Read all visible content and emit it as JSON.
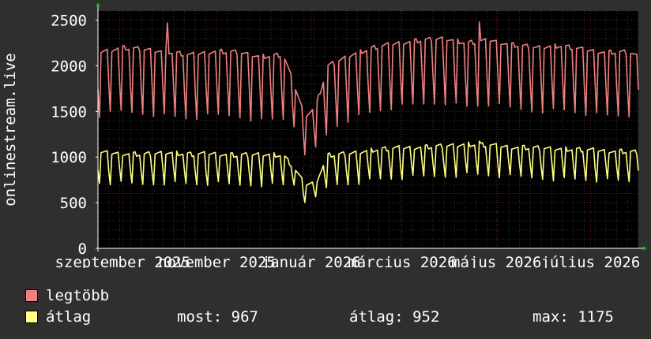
{
  "chart_data": {
    "type": "line",
    "title": "",
    "ylabel": "onlinestream.live",
    "xlabel": "",
    "ylim": [
      0,
      2600
    ],
    "yticks": [
      0,
      500,
      1000,
      1500,
      2000,
      2500
    ],
    "ytick_labels": [
      "0",
      "500",
      "1000",
      "1500",
      "2000",
      "2500"
    ],
    "xlim": [
      "2025-08-16",
      "2026-08-01"
    ],
    "xtick_labels": [
      {
        "label": "szeptember 2025",
        "date": "2025-09-01"
      },
      {
        "label": "november 2025",
        "date": "2025-11-01"
      },
      {
        "label": "január 2026",
        "date": "2026-01-01"
      },
      {
        "label": "március 2026",
        "date": "2026-03-01"
      },
      {
        "label": "május 2026",
        "date": "2026-05-01"
      },
      {
        "label": "július 2026",
        "date": "2026-07-01"
      }
    ],
    "series": [
      {
        "name": "legtöbb",
        "color": "#f08080",
        "points": [
          [
            "2025-08-16",
            2150
          ],
          [
            "2025-08-31",
            2200
          ],
          [
            "2025-09-15",
            2180
          ],
          [
            "2025-09-30",
            2150
          ],
          [
            "2025-10-15",
            2120
          ],
          [
            "2025-10-30",
            2160
          ],
          [
            "2025-11-14",
            2150
          ],
          [
            "2025-11-29",
            2100
          ],
          [
            "2025-12-14",
            2120
          ],
          [
            "2025-12-21",
            1800
          ],
          [
            "2025-12-28",
            1450
          ],
          [
            "2026-01-04",
            1550
          ],
          [
            "2026-01-12",
            2000
          ],
          [
            "2026-01-27",
            2120
          ],
          [
            "2026-02-11",
            2200
          ],
          [
            "2026-02-26",
            2250
          ],
          [
            "2026-03-13",
            2280
          ],
          [
            "2026-03-28",
            2300
          ],
          [
            "2026-04-12",
            2250
          ],
          [
            "2026-04-27",
            2280
          ],
          [
            "2026-05-12",
            2230
          ],
          [
            "2026-05-27",
            2200
          ],
          [
            "2026-06-11",
            2220
          ],
          [
            "2026-06-26",
            2180
          ],
          [
            "2026-07-11",
            2150
          ],
          [
            "2026-07-26",
            2150
          ],
          [
            "2026-08-01",
            2100
          ]
        ],
        "weekly_dip": 700,
        "low_season_dip": 450,
        "peaks": [
          [
            "2025-09-30",
            2470
          ],
          [
            "2026-04-20",
            2480
          ]
        ]
      },
      {
        "name": "átlag",
        "color": "#ffff80",
        "points": [
          [
            "2025-08-16",
            1050
          ],
          [
            "2025-08-31",
            1040
          ],
          [
            "2025-09-15",
            1030
          ],
          [
            "2025-09-30",
            1050
          ],
          [
            "2025-10-15",
            1030
          ],
          [
            "2025-10-30",
            1040
          ],
          [
            "2025-11-14",
            1020
          ],
          [
            "2025-11-29",
            1030
          ],
          [
            "2025-12-14",
            1020
          ],
          [
            "2025-12-21",
            880
          ],
          [
            "2025-12-28",
            700
          ],
          [
            "2026-01-04",
            720
          ],
          [
            "2026-01-12",
            1020
          ],
          [
            "2026-01-27",
            1040
          ],
          [
            "2026-02-11",
            1080
          ],
          [
            "2026-02-26",
            1100
          ],
          [
            "2026-03-13",
            1110
          ],
          [
            "2026-03-28",
            1120
          ],
          [
            "2026-04-12",
            1140
          ],
          [
            "2026-04-27",
            1130
          ],
          [
            "2026-05-12",
            1110
          ],
          [
            "2026-05-27",
            1100
          ],
          [
            "2026-06-11",
            1090
          ],
          [
            "2026-06-26",
            1080
          ],
          [
            "2026-07-11",
            1070
          ],
          [
            "2026-07-26",
            1060
          ],
          [
            "2026-08-01",
            1050
          ]
        ],
        "weekly_dip": 330,
        "low_season_dip": 180,
        "peaks": [
          [
            "2026-04-20",
            1175
          ]
        ]
      }
    ],
    "grid": true,
    "legend_position": "bottom-left"
  },
  "legend": {
    "items": [
      {
        "label": "legtöbb",
        "color": "#f08080"
      },
      {
        "label": "átlag",
        "color": "#ffff80"
      }
    ],
    "stats": {
      "now": "most: 967",
      "avg": "átlag: 952",
      "max": "max: 1175"
    }
  },
  "colors": {
    "background": "#2f2f2f",
    "plot_background": "#000000",
    "grid_minor": "#303030",
    "grid_major": "#5a2020",
    "axis": "#ffffff",
    "arrow": "#00c000"
  }
}
